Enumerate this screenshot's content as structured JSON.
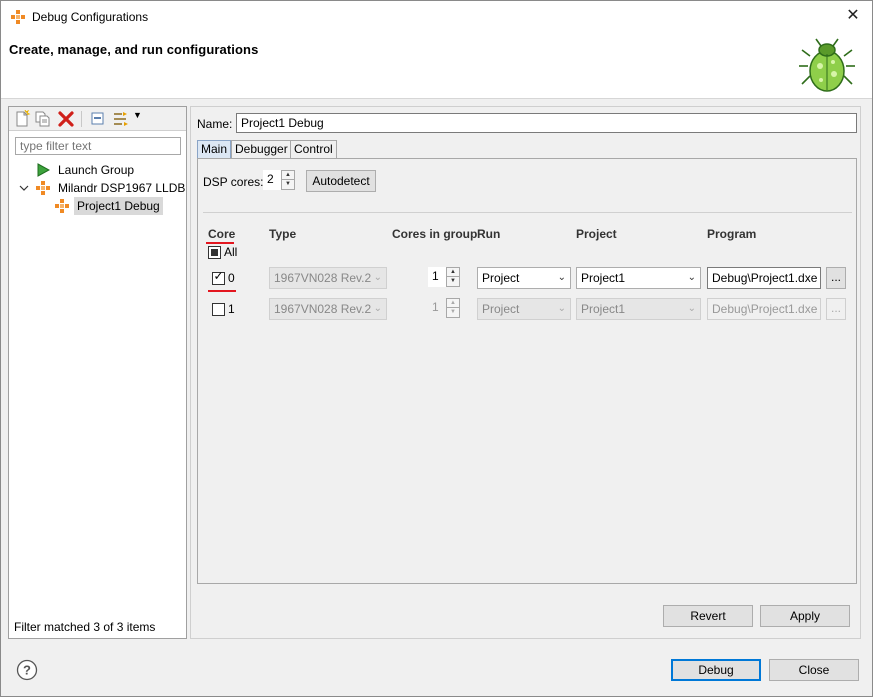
{
  "window": {
    "title": "Debug Configurations",
    "subtitle": "Create, manage, and run configurations"
  },
  "sidebar": {
    "filter_placeholder": "type filter text",
    "tree": [
      {
        "label": "Launch Group",
        "icon": "launch-group-icon",
        "level": 1,
        "selected": false
      },
      {
        "label": "Milandr DSP1967 LLDB",
        "icon": "dsp-debug-type-icon",
        "level": 0,
        "expanded": true,
        "selected": false
      },
      {
        "label": "Project1 Debug",
        "icon": "dsp-debug-config-icon",
        "level": 1,
        "selected": true
      }
    ],
    "status": "Filter matched 3 of 3 items"
  },
  "editor": {
    "name_label": "Name:",
    "name_value": "Project1 Debug",
    "tabs": [
      {
        "label": "Main",
        "active": true
      },
      {
        "label": "Debugger",
        "active": false
      },
      {
        "label": "Control",
        "active": false
      }
    ],
    "dsp_cores_label": "DSP cores:",
    "dsp_cores_value": "2",
    "autodetect_label": "Autodetect",
    "columns": {
      "core": "Core",
      "type": "Type",
      "cores_in_group": "Cores in group",
      "run": "Run",
      "project": "Project",
      "program": "Program"
    },
    "all_label": "All",
    "rows": [
      {
        "core": "0",
        "checked": true,
        "type": "1967VN028 Rev.2",
        "cores_in_group": "1",
        "run": "Project",
        "project": "Project1",
        "program": "Debug\\Project1.dxe",
        "enabled": true
      },
      {
        "core": "1",
        "checked": false,
        "type": "1967VN028 Rev.2",
        "cores_in_group": "1",
        "run": "Project",
        "project": "Project1",
        "program": "Debug\\Project1.dxe",
        "enabled": false
      }
    ],
    "browse_label": "...",
    "revert_label": "Revert",
    "apply_label": "Apply"
  },
  "footer": {
    "debug_label": "Debug",
    "close_label": "Close"
  },
  "colors": {
    "accent": "#0078d7",
    "selection": "#d9d9d9",
    "active_tab": "#dce7f4",
    "annotation_red": "#e3161f"
  }
}
